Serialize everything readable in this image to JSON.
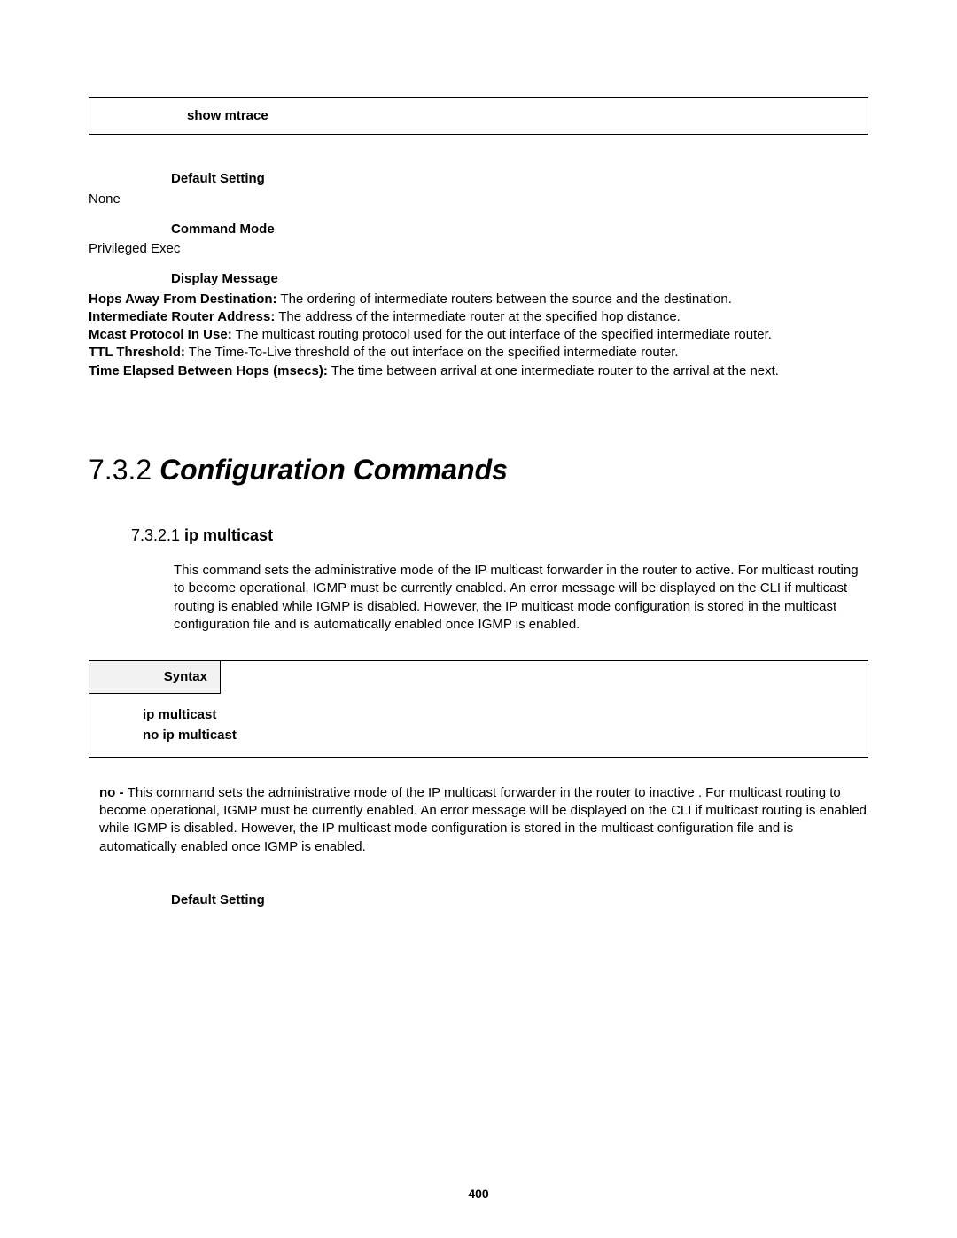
{
  "box1": {
    "command": "show mtrace"
  },
  "s1": {
    "defaultLabel": "Default Setting",
    "defaultValue": "None",
    "modeLabel": "Command Mode",
    "modeValue": "Privileged Exec",
    "displayLabel": "Display Message",
    "msg1a": "Hops Away From Destination:",
    "msg1b": " The ordering of intermediate routers between the source and the destination.",
    "msg2a": "Intermediate Router Address:",
    "msg2b": " The address of the intermediate router at the specified hop distance.",
    "msg3a": "Mcast Protocol In Use:",
    "msg3b": " The multicast routing protocol used for the out interface of the specified intermediate router.",
    "msg4a": "TTL Threshold:",
    "msg4b": " The Time-To-Live threshold of the out interface on the specified intermediate router.",
    "msg5a": "Time Elapsed Between Hops (msecs):",
    "msg5b": " The time between arrival at one intermediate router to the arrival at the next."
  },
  "h2": {
    "num": "7.3.2 ",
    "title": "Configuration Commands"
  },
  "h3": {
    "num": "7.3.2.1 ",
    "title": "ip multicast"
  },
  "desc": "This command sets the administrative mode of the IP multicast forwarder in the router to active. For multicast routing to become operational, IGMP must be currently enabled. An error message will be displayed on the CLI if multicast routing is enabled while IGMP is disabled. However, the IP multicast mode configuration is stored in the multicast configuration file and is automatically enabled once IGMP is enabled.",
  "syntax": {
    "label": "Syntax",
    "line1": "ip multicast",
    "line2": "no ip multicast"
  },
  "noDesc": {
    "bold": "no - ",
    "text": "This command sets the administrative mode of the IP multicast forwarder in the router to inactive . For multicast routing to become operational, IGMP must be currently enabled. An error message will be displayed on the CLI if multicast routing is enabled while IGMP is disabled. However, the IP multicast mode configuration is stored in the multicast configuration file and is automatically enabled once IGMP is enabled."
  },
  "defaultLabel2": "Default Setting",
  "pageNumber": "400"
}
